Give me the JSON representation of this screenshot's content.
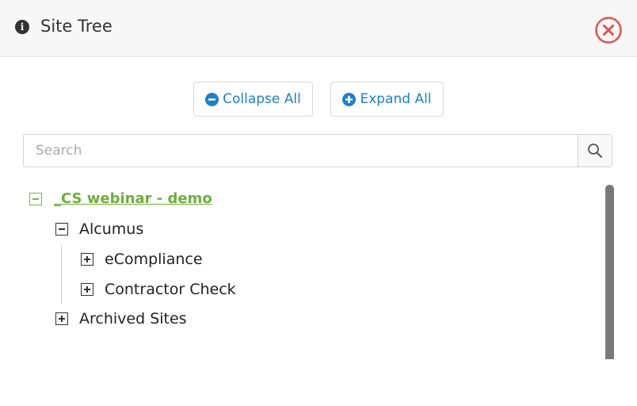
{
  "header": {
    "title": "Site Tree",
    "info_icon": "info-circle-icon",
    "close_icon": "close-circle-icon",
    "close_color": "#e0544a"
  },
  "toolbar": {
    "collapse_label": "Collapse All",
    "expand_label": "Expand All",
    "collapse_icon": "minus-circle-icon",
    "expand_icon": "plus-circle-icon",
    "accent_color": "#1f80c8"
  },
  "search": {
    "placeholder": "Search",
    "value": "",
    "icon": "search-icon"
  },
  "tree": {
    "root": {
      "label": "_CS webinar - demo",
      "expanded": true,
      "color": "#6fae3a"
    },
    "items": [
      {
        "label": "Alcumus",
        "expanded": true
      },
      {
        "label": "eCompliance",
        "expanded": false
      },
      {
        "label": "Contractor Check",
        "expanded": false
      },
      {
        "label": "Archived Sites",
        "expanded": false
      }
    ]
  }
}
